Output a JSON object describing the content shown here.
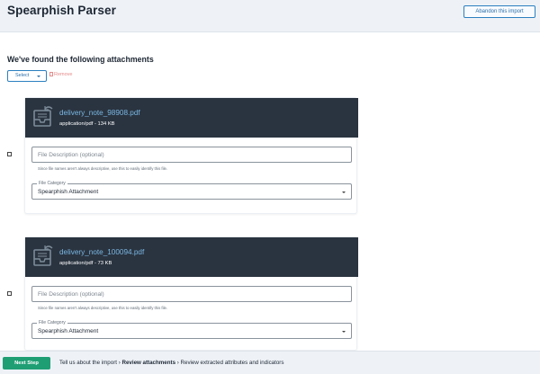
{
  "header": {
    "title": "Spearphish Parser",
    "abandon_label": "Abandon this import"
  },
  "main": {
    "heading": "We've found the following attachments",
    "select_label": "Select",
    "remove_label": "Remove",
    "attachments": [
      {
        "file_name": "delivery_note_98908.pdf",
        "file_meta": "application/pdf - 134 KB",
        "description_placeholder": "File Description (optional)",
        "description_value": "",
        "helper_text": "Since file names aren't always descriptive, use this to easily identify this file.",
        "category_label": "File Category",
        "category_value": "Spearphish Attachment"
      },
      {
        "file_name": "delivery_note_100094.pdf",
        "file_meta": "application/pdf - 73 KB",
        "description_placeholder": "File Description (optional)",
        "description_value": "",
        "helper_text": "Since file names aren't always descriptive, use this to easily identify this file.",
        "category_label": "File Category",
        "category_value": "Spearphish Attachment"
      }
    ]
  },
  "footer": {
    "next_label": "Next Step",
    "steps": [
      "Tell us about the import",
      "Review attachments",
      "Review extracted attributes and indicators"
    ],
    "separator": "›",
    "current_step": "Review attachments"
  },
  "icons": {
    "file": "inbox-file-icon",
    "trash": "trash-icon",
    "caret": "chevron-down-icon"
  },
  "colors": {
    "accent": "#2c7fc0",
    "card_header": "#2a3440",
    "file_name": "#7ab6e2",
    "next_button": "#1f9e74",
    "remove": "#e58b8b",
    "chrome": "#eef2f7"
  }
}
